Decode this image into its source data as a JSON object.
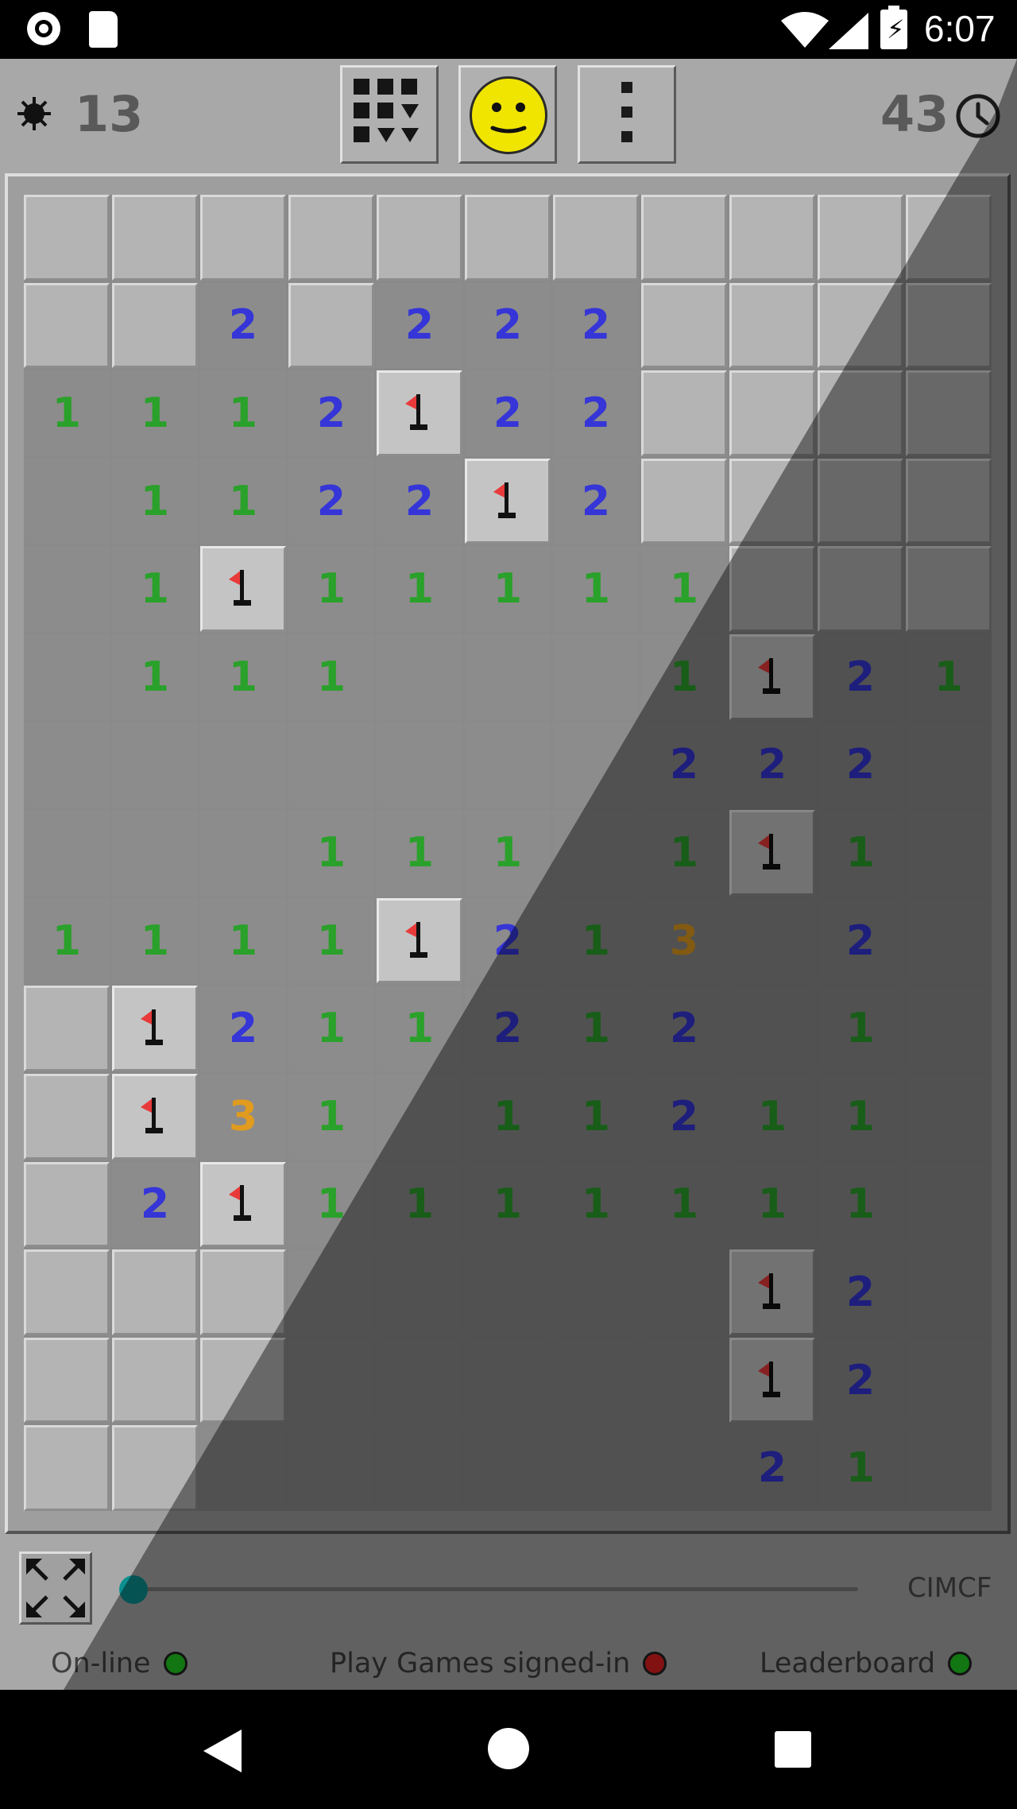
{
  "status_bar": {
    "time": "6:07",
    "icons": [
      "screen-record-icon",
      "sd-card-icon",
      "wifi-icon",
      "signal-icon",
      "battery-charging-icon"
    ]
  },
  "header": {
    "mines_remaining": "13",
    "timer": "43",
    "face": "neutral-smiley",
    "buttons": [
      "grid-select-icon",
      "smiley-reset-icon",
      "overflow-menu-icon"
    ]
  },
  "board": {
    "cols": 11,
    "rows": 15,
    "legend": "C = covered, O = open (blank), F = flag, 1/2/3 = revealed number",
    "cells": [
      "CCCCCCCCCCC",
      "CC2C222CCCC",
      "1112F22CCCC",
      "O1122F2CCCC",
      "O1F11111CCC",
      "O111OOO1F21",
      "OOOOOOO222O",
      "OOO111O1F1O",
      "1111F213O2O",
      "CF211212O1O",
      "CF31O11211O",
      "C2F1111111O",
      "CCCOOOOOF2O",
      "CCCOOOOOF2O",
      "CCOOOOOO21O"
    ]
  },
  "footer": {
    "expand_icon": "expand-arrows-icon",
    "zoom_slider_value": 0,
    "cimcf_label": "CIMCF",
    "online_label": "On-line",
    "online_status": "green",
    "play_games_label": "Play Games signed-in",
    "play_games_status": "red",
    "leaderboard_label": "Leaderboard",
    "leaderboard_status": "green"
  },
  "colors": {
    "number_1": "#2aa12a",
    "number_2": "#3535d8",
    "number_3": "#e19b1e",
    "flag": "#e83a3a",
    "face": "#f0e500"
  },
  "nav_bar": {
    "icons": [
      "back-icon",
      "home-icon",
      "recents-icon"
    ]
  }
}
